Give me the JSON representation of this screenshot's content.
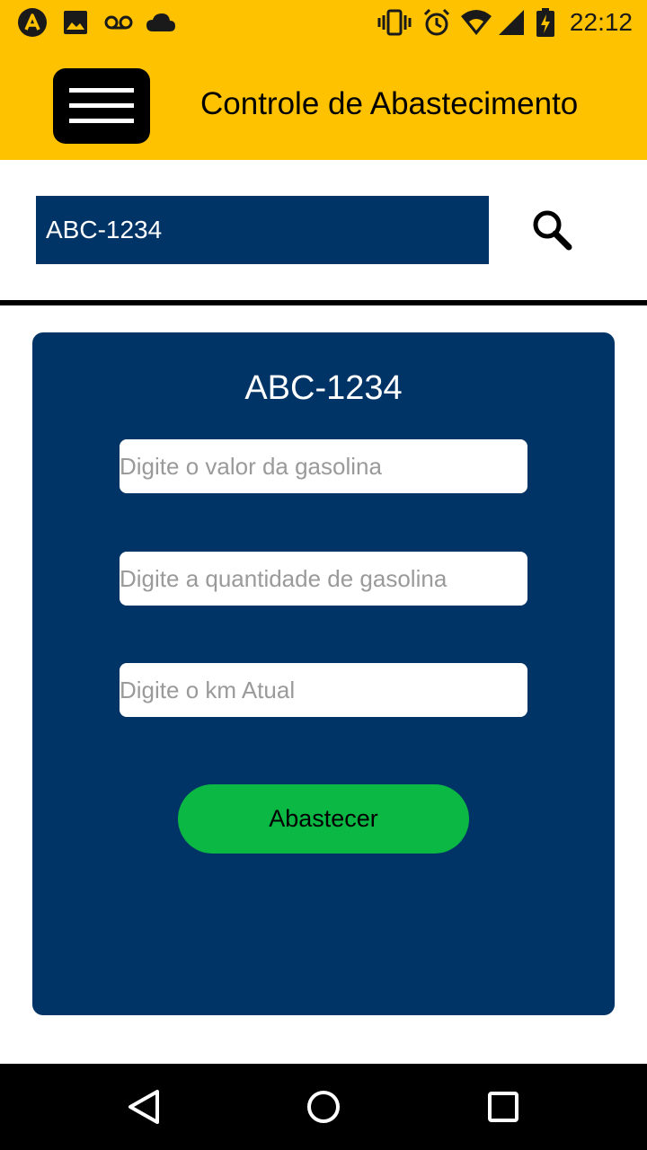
{
  "status_bar": {
    "time": "22:12",
    "icons": [
      "app-launcher-icon",
      "image-icon",
      "voicemail-icon",
      "cloud-icon",
      "vibrate-icon",
      "alarm-icon",
      "wifi-icon",
      "signal-icon",
      "battery-charging-icon"
    ]
  },
  "header": {
    "title": "Controle de Abastecimento",
    "menu_icon": "hamburger-menu-icon",
    "background": "#fec200"
  },
  "search": {
    "value": "ABC-1234",
    "icon": "search-icon",
    "background": "#003466"
  },
  "card": {
    "plate": "ABC-1234",
    "background": "#003466",
    "fields": {
      "fuel_price_placeholder": "Digite o valor da gasolina",
      "fuel_quantity_placeholder": "Digite a quantidade de gasolina",
      "current_km_placeholder": "Digite o km Atual"
    },
    "submit_label": "Abastecer",
    "submit_color": "#0bb844"
  },
  "nav_bar": {
    "icons": [
      "back-icon",
      "home-icon",
      "recents-icon"
    ]
  }
}
